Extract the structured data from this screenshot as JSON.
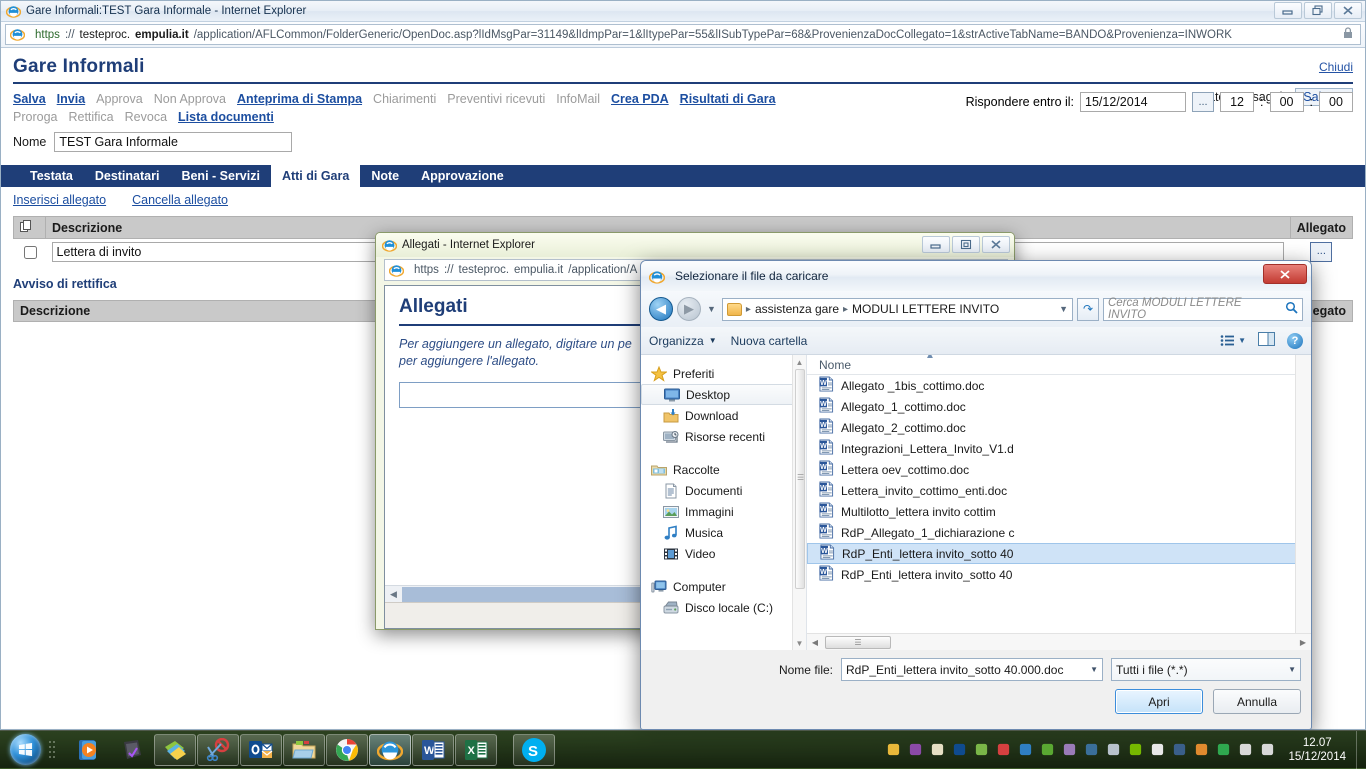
{
  "browser": {
    "title": "Gare Informali:TEST Gara Informale - Internet Explorer",
    "url_scheme": "https",
    "url_sep": "://",
    "url_host_pre": "testeproc.",
    "url_host_bold": "empulia.it",
    "url_path": "/application/AFLCommon/FolderGeneric/OpenDoc.asp?lIdMsgPar=31149&lIdmpPar=1&lItypePar=55&lISubTypePar=68&ProvenienzaDocCollegato=1&strActiveTabName=BANDO&Provenienza=INWORK",
    "minimize_label": "Riduci a icona",
    "restore_label": "Ripristina",
    "close_label": "Chiudi"
  },
  "app": {
    "title": "Gare Informali",
    "close_link": "Chiudi",
    "commands_row1": [
      {
        "label": "Salva",
        "enabled": true
      },
      {
        "label": "Invia",
        "enabled": true
      },
      {
        "label": "Approva",
        "enabled": false
      },
      {
        "label": "Non Approva",
        "enabled": false
      },
      {
        "label": "Anteprima di Stampa",
        "enabled": true
      },
      {
        "label": "Chiarimenti",
        "enabled": false
      },
      {
        "label": "Preventivi ricevuti",
        "enabled": false
      },
      {
        "label": "InfoMail",
        "enabled": false
      },
      {
        "label": "Crea PDA",
        "enabled": true
      },
      {
        "label": "Risultati di Gara",
        "enabled": true
      }
    ],
    "commands_row2": [
      {
        "label": "Proroga",
        "enabled": false
      },
      {
        "label": "Rettifica",
        "enabled": false
      },
      {
        "label": "Revoca",
        "enabled": false
      },
      {
        "label": "Lista documenti",
        "enabled": true
      }
    ],
    "status_label": "Stato Messaggio",
    "status_value": "Salvato",
    "name_label": "Nome",
    "name_value": "TEST Gara Informale",
    "deadline_label": "Rispondere entro il:",
    "deadline_date": "15/12/2014",
    "deadline_picker": "...",
    "deadline_hh": "12",
    "deadline_mm": "00",
    "deadline_ss": "00",
    "sep1": ":",
    "sep2": ":",
    "tabs": [
      {
        "label": "Testata",
        "active": false
      },
      {
        "label": "Destinatari",
        "active": false
      },
      {
        "label": "Beni - Servizi",
        "active": false
      },
      {
        "label": "Atti di Gara",
        "active": true
      },
      {
        "label": "Note",
        "active": false
      },
      {
        "label": "Approvazione",
        "active": false
      }
    ],
    "sublinks": [
      {
        "label": "Inserisci allegato"
      },
      {
        "label": "Cancella allegato"
      }
    ],
    "table1": {
      "headers": [
        "",
        "Descrizione",
        "Allegato"
      ],
      "copy_icon": "copy-icon",
      "rows": [
        {
          "checked": false,
          "descrizione": "Lettera di invito",
          "allegato_btn": "..."
        }
      ]
    },
    "section2_title": "Avviso di rettifica",
    "table2": {
      "headers": [
        "Descrizione",
        "Allegato"
      ],
      "rows": []
    }
  },
  "allegati_popup": {
    "title": "Allegati - Internet Explorer",
    "url_scheme": "https",
    "url_sep": "://",
    "url_host_pre": "testeproc.",
    "url_host_bold": "empulia.it",
    "url_path": "/application/A",
    "heading": "Allegati",
    "instructions_line1": "Per aggiungere un allegato, digitare un pe",
    "instructions_line2": "per aggiungere l'allegato.",
    "file_input_value": "",
    "minimize_label": "Riduci a icona",
    "restore_label": "Ripristina",
    "close_label": "Chiudi"
  },
  "file_dialog": {
    "title": "Selezionare il file da caricare",
    "close_label": "Chiudi",
    "back_label": "Indietro",
    "forward_label": "Avanti",
    "recent_label": "Percorsi recenti",
    "breadcrumb": [
      "assistenza gare",
      "MODULI LETTERE INVITO"
    ],
    "breadcrumb_sep": "▸",
    "refresh_label": "Aggiorna",
    "search_placeholder": "Cerca MODULI LETTERE INVITO",
    "toolbar": {
      "organizza": "Organizza",
      "nuova_cartella": "Nuova cartella",
      "view_label": "Cambia visualizzazione",
      "preview_label": "Riquadro anteprima",
      "help_label": "?"
    },
    "sidebar": [
      {
        "label": "Preferiti",
        "icon": "star-icon",
        "level": 1,
        "selected": false
      },
      {
        "label": "Desktop",
        "icon": "desktop-icon",
        "level": 2,
        "selected": true
      },
      {
        "label": "Download",
        "icon": "download-icon",
        "level": 2,
        "selected": false
      },
      {
        "label": "Risorse recenti",
        "icon": "recent-places-icon",
        "level": 2,
        "selected": false
      },
      {
        "label": "Raccolte",
        "icon": "libraries-icon",
        "level": 1,
        "selected": false
      },
      {
        "label": "Documenti",
        "icon": "documents-icon",
        "level": 2,
        "selected": false
      },
      {
        "label": "Immagini",
        "icon": "pictures-icon",
        "level": 2,
        "selected": false
      },
      {
        "label": "Musica",
        "icon": "music-icon",
        "level": 2,
        "selected": false
      },
      {
        "label": "Video",
        "icon": "video-icon",
        "level": 2,
        "selected": false
      },
      {
        "label": "Computer",
        "icon": "computer-icon",
        "level": 1,
        "selected": false
      },
      {
        "label": "Disco locale (C:)",
        "icon": "harddisk-icon",
        "level": 2,
        "selected": false
      }
    ],
    "list_header": "Nome",
    "files": [
      {
        "name": "Allegato _1bis_cottimo.doc",
        "selected": false
      },
      {
        "name": "Allegato_1_cottimo.doc",
        "selected": false
      },
      {
        "name": "Allegato_2_cottimo.doc",
        "selected": false
      },
      {
        "name": "Integrazioni_Lettera_Invito_V1.d",
        "selected": false
      },
      {
        "name": "Lettera oev_cottimo.doc",
        "selected": false
      },
      {
        "name": "Lettera_invito_cottimo_enti.doc",
        "selected": false
      },
      {
        "name": "Multilotto_lettera invito cottim",
        "selected": false
      },
      {
        "name": "RdP_Allegato_1_dichiarazione c",
        "selected": false
      },
      {
        "name": "RdP_Enti_lettera invito_sotto 40",
        "selected": true
      },
      {
        "name": "RdP_Enti_lettera invito_sotto 40",
        "selected": false
      }
    ],
    "filename_label": "Nome file:",
    "filename_value": "RdP_Enti_lettera invito_sotto 40.000.doc",
    "filter_value": "Tutti i file (*.*)",
    "open_button": "Apri",
    "cancel_button": "Annulla"
  },
  "taskbar": {
    "start_label": "Start",
    "quick_launch": [
      {
        "name": "windows-media-player-icon",
        "open": false
      },
      {
        "name": "vaio-notes-icon",
        "open": false
      }
    ],
    "apps": [
      {
        "name": "sticky-notes-icon",
        "state": "open"
      },
      {
        "name": "snipping-tool-icon",
        "state": "open"
      },
      {
        "name": "outlook-icon",
        "state": "open"
      },
      {
        "name": "file-explorer-icon",
        "state": "open"
      },
      {
        "name": "chrome-icon",
        "state": "open"
      },
      {
        "name": "internet-explorer-icon",
        "state": "active"
      },
      {
        "name": "word-icon",
        "state": "open"
      },
      {
        "name": "excel-icon",
        "state": "open"
      },
      {
        "name": "skype-icon",
        "state": "open"
      }
    ],
    "tray_icons": [
      "shield-icon",
      "onenote-clip-icon",
      "mail-icon",
      "outlook-tray-icon",
      "shield-green-icon",
      "volume-mute-icon",
      "calendar-icon",
      "check-icon",
      "vaio-care-icon",
      "pen-icon",
      "display-icon",
      "nvidia-icon",
      "flag-icon",
      "network-monitor-icon",
      "dropbox-icon",
      "sync-icon",
      "signal-icon",
      "battery-icon"
    ],
    "clock_time": "12.07",
    "clock_date": "15/12/2014"
  }
}
